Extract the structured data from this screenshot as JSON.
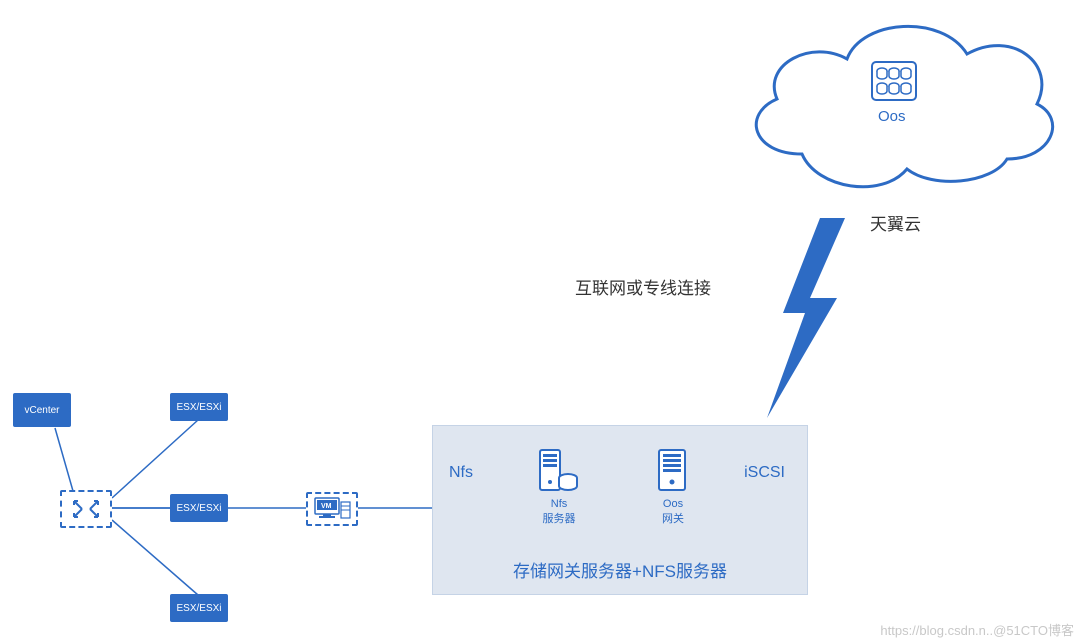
{
  "nodes": {
    "vcenter": "vCenter",
    "esx1": "ESX/ESXi",
    "esx2": "ESX/ESXi",
    "esx3": "ESX/ESXi",
    "vm": "VM"
  },
  "gateway": {
    "left_protocol": "Nfs",
    "right_protocol": "iSCSI",
    "nfs_server_label_line1": "Nfs",
    "nfs_server_label_line2": "服务器",
    "oos_gw_label_line1": "Oos",
    "oos_gw_label_line2": "网关",
    "caption": "存储网关服务器+NFS服务器"
  },
  "cloud": {
    "service": "Oos",
    "name": "天翼云"
  },
  "connection_label": "互联网或专线连接",
  "watermark": "https://blog.csdn.n..@51CTO博客"
}
